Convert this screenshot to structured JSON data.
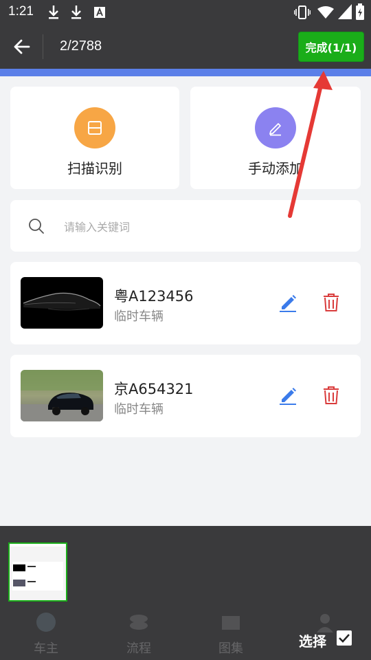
{
  "status_bar": {
    "time": "1:21"
  },
  "header": {
    "page_counter": "2/2788",
    "done_label": "完成(1/1)"
  },
  "actions": [
    {
      "label": "扫描识别",
      "icon": "scan-icon",
      "color": "#f7a645"
    },
    {
      "label": "手动添加",
      "icon": "pen-icon",
      "color": "#8b82f0"
    }
  ],
  "search": {
    "placeholder": "请输入关键词",
    "value": ""
  },
  "vehicles": [
    {
      "plate": "粤A123456",
      "type": "临时车辆"
    },
    {
      "plate": "京A654321",
      "type": "临时车辆"
    }
  ],
  "tabs": [
    {
      "label": "车主",
      "icon": "car-icon"
    },
    {
      "label": "流程",
      "icon": "process-icon"
    },
    {
      "label": "图集",
      "icon": "gallery-icon"
    },
    {
      "label": "",
      "icon": "person-icon"
    }
  ],
  "bottom": {
    "select_label": "选择",
    "select_checked": true
  },
  "colors": {
    "accent_strip": "#5b7fe8",
    "done_green": "#1aad19",
    "delete_red": "#d93b3b",
    "edit_blue": "#3b7bea",
    "annotation_arrow": "#e53935"
  }
}
